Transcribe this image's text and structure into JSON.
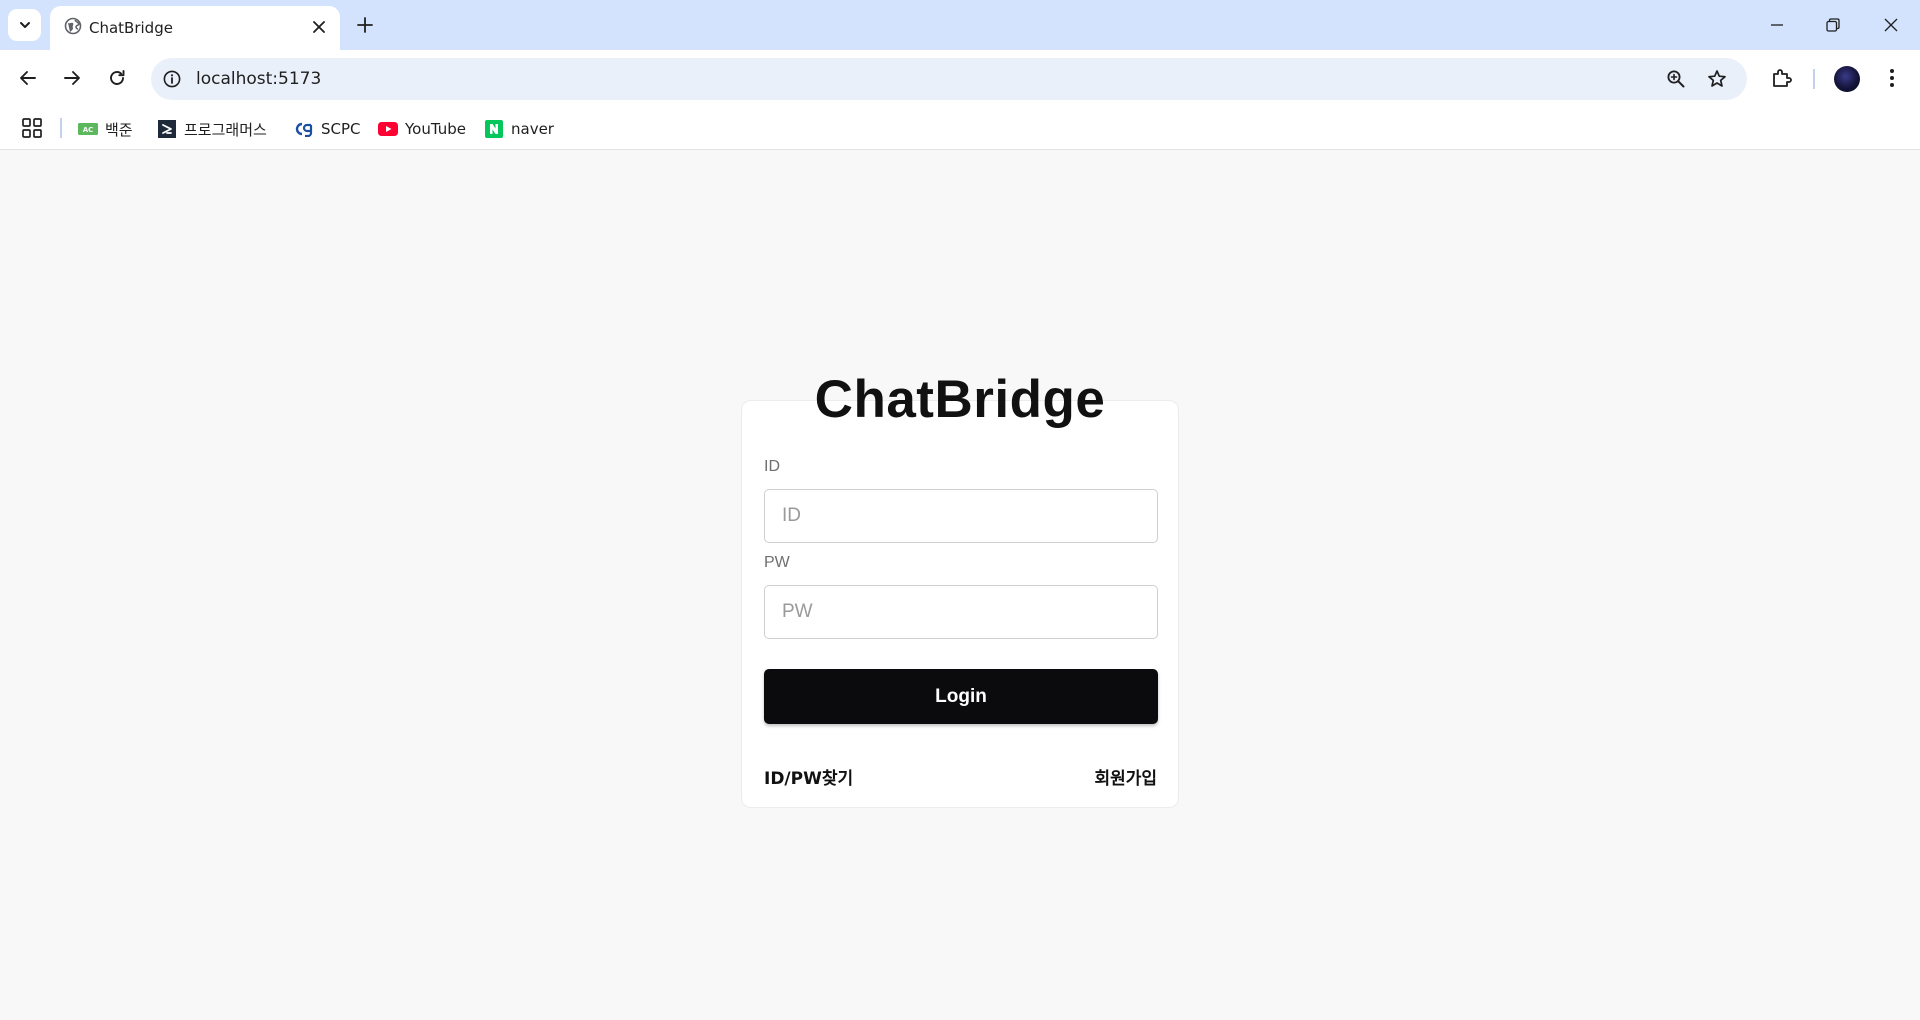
{
  "browser": {
    "tab": {
      "title": "ChatBridge"
    },
    "address": {
      "url": "localhost:5173"
    },
    "bookmarks": [
      {
        "label": "백준",
        "icon": "acmicpc-icon"
      },
      {
        "label": "프로그래머스",
        "icon": "programmers-icon"
      },
      {
        "label": "SCPC",
        "icon": "scpc-icon"
      },
      {
        "label": "YouTube",
        "icon": "youtube-icon"
      },
      {
        "label": "naver",
        "icon": "naver-icon"
      }
    ]
  },
  "login": {
    "brand": "ChatBridge",
    "id_label": "ID",
    "id_placeholder": "ID",
    "pw_label": "PW",
    "pw_placeholder": "PW",
    "submit_label": "Login",
    "find_link": "ID/PW찾기",
    "signup_link": "회원가입"
  },
  "colors": {
    "tabbar": "#d3e3fd",
    "omnibox": "#eaf0fa",
    "page_background": "#f8f8f8",
    "button": "#0b0b0d"
  }
}
